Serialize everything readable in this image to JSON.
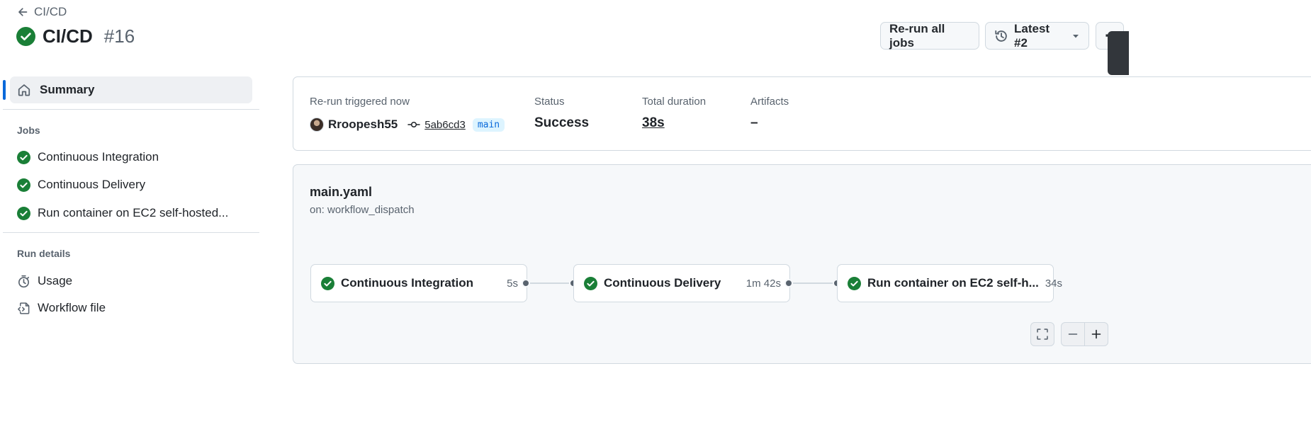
{
  "header": {
    "back_label": "CI/CD",
    "workflow_title": "CI/CD",
    "run_number": "#16",
    "status": "success",
    "rerun_button": "Re-run all jobs",
    "attempt_button": "Latest #2",
    "more_button": "⋯"
  },
  "sidebar": {
    "summary_label": "Summary",
    "jobs_heading": "Jobs",
    "jobs": [
      {
        "label": "Continuous Integration",
        "status": "success"
      },
      {
        "label": "Continuous Delivery",
        "status": "success"
      },
      {
        "label": "Run container on EC2 self-hosted...",
        "status": "success"
      }
    ],
    "run_details_heading": "Run details",
    "usage_label": "Usage",
    "workflow_file_label": "Workflow file"
  },
  "summary": {
    "trigger_label": "Re-run triggered now",
    "actor": "Rroopesh55",
    "commit": "5ab6cd3",
    "branch": "main",
    "status_label": "Status",
    "status_value": "Success",
    "duration_label": "Total duration",
    "duration_value": "38s",
    "artifacts_label": "Artifacts",
    "artifacts_value": "–"
  },
  "graph": {
    "file": "main.yaml",
    "trigger": "on: workflow_dispatch",
    "jobs": [
      {
        "name": "Continuous Integration",
        "duration": "5s",
        "status": "success"
      },
      {
        "name": "Continuous Delivery",
        "duration": "1m 42s",
        "status": "success"
      },
      {
        "name": "Run container on EC2 self-h...",
        "duration": "34s",
        "status": "success"
      }
    ]
  },
  "colors": {
    "success": "#1a7f37",
    "accent": "#0969da",
    "border": "#d1d9e0",
    "muted_text": "#59636e"
  },
  "icons": {
    "back": "arrow-left-icon",
    "status": "check-circle-fill-icon",
    "history": "history-icon",
    "caret": "triangle-down-icon",
    "home": "home-icon",
    "usage": "stopwatch-icon",
    "workflow_file": "file-code-icon",
    "commit": "git-commit-icon",
    "fullscreen": "screen-full-icon",
    "zoom_out": "dash-icon",
    "zoom_in": "plus-icon"
  }
}
